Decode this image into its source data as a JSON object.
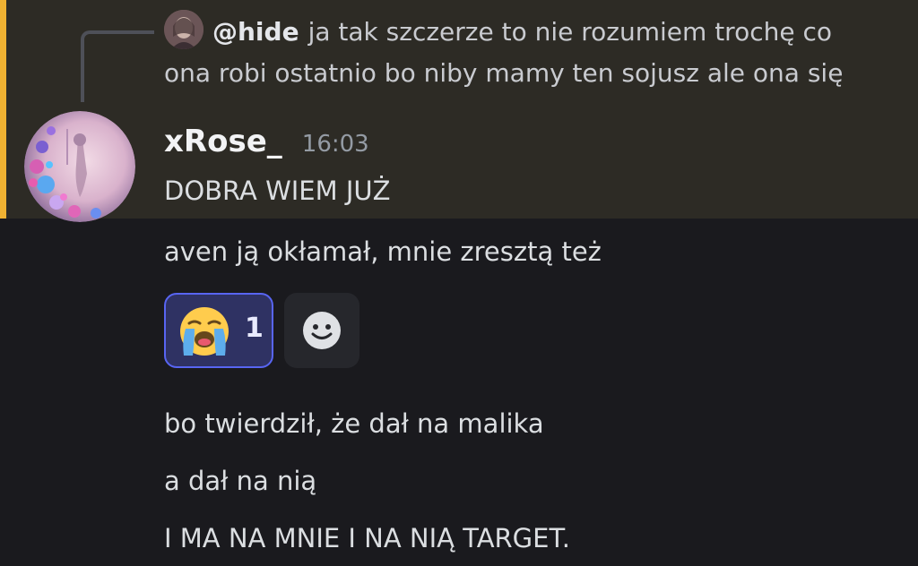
{
  "reply": {
    "username": "@hide",
    "text": "ja tak szczerze to nie rozumiem trochę co ona robi ostatnio bo niby mamy ten sojusz ale ona się"
  },
  "message": {
    "author": "xRose_",
    "timestamp": "16:03",
    "lines": [
      "DOBRA WIEM JUŻ",
      "aven ją okłamał, mnie zresztą też"
    ],
    "reaction": {
      "emoji_icon": "loudly-crying-face-icon",
      "count": "1"
    },
    "add_reaction_icon": "smiley-add-reaction-icon",
    "followup_lines": [
      "bo twierdził, że dał na malika",
      "a dał na nią",
      "I MA NA MNIE I NA NIĄ TARGET."
    ]
  },
  "colors": {
    "background": "#1a1a1e",
    "highlight_background": "#2d2b25",
    "highlight_bar": "#f0b232",
    "reaction_border": "#5865f2",
    "reaction_background": "#2f3263"
  }
}
